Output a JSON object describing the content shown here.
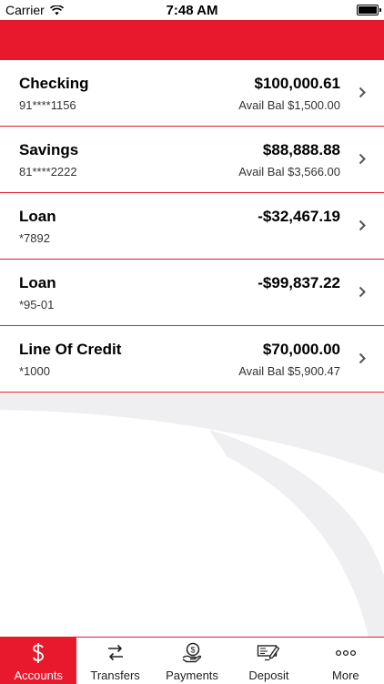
{
  "status_bar": {
    "carrier": "Carrier",
    "time": "7:48 AM",
    "battery_level": 1.0
  },
  "accounts": [
    {
      "name": "Checking",
      "number": "91****1156",
      "balance": "$100,000.61",
      "avail": "Avail Bal $1,500.00"
    },
    {
      "name": "Savings",
      "number": "81****2222",
      "balance": "$88,888.88",
      "avail": "Avail Bal $3,566.00"
    },
    {
      "name": "Loan",
      "number": "*7892",
      "balance": "-$32,467.19",
      "avail": ""
    },
    {
      "name": "Loan",
      "number": "*95-01",
      "balance": "-$99,837.22",
      "avail": ""
    },
    {
      "name": "Line Of Credit",
      "number": "*1000",
      "balance": "$70,000.00",
      "avail": "Avail Bal $5,900.47"
    }
  ],
  "tabs": [
    {
      "label": "Accounts",
      "icon": "dollar-icon",
      "active": true
    },
    {
      "label": "Transfers",
      "icon": "transfer-icon",
      "active": false
    },
    {
      "label": "Payments",
      "icon": "payments-icon",
      "active": false
    },
    {
      "label": "Deposit",
      "icon": "check-deposit-icon",
      "active": false
    },
    {
      "label": "More",
      "icon": "more-icon",
      "active": false
    }
  ],
  "colors": {
    "brand": "#e8192c",
    "chevron": "#555555",
    "decor": "#efeff1"
  }
}
